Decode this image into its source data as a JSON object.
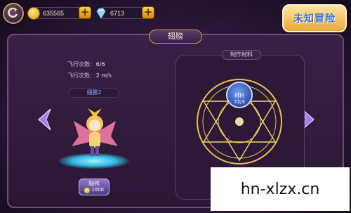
{
  "header": {
    "gold": "635565",
    "diamonds": "6713",
    "logo_text": "未知冒险"
  },
  "panel": {
    "title": "翅膀",
    "stats": [
      {
        "label": "飞行次数:",
        "value": "6/6"
      },
      {
        "label": "飞行次数:",
        "value": "2 m/s"
      }
    ],
    "item_name": "翅膀2",
    "craft_button": {
      "label": "制作",
      "cost": "1000"
    }
  },
  "materials": {
    "title": "制作材料",
    "slot": {
      "name": "材料",
      "count": "72/3"
    }
  },
  "watermark": "hn-xlzx.cn",
  "colors": {
    "gold": "#f0c030",
    "accent": "#8d6ad8",
    "rune": "#e7c24a"
  },
  "icons": {
    "back": "back-arrow-icon",
    "gold": "coin-icon",
    "diamond": "diamond-icon",
    "left": "chevron-left-icon",
    "right": "chevron-right-icon"
  }
}
